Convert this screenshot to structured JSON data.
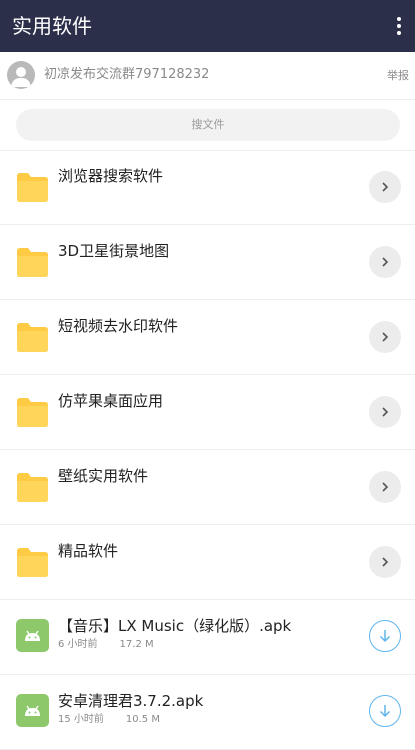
{
  "appbar": {
    "title": "实用软件",
    "menu_icon": "more-vert-icon"
  },
  "owner": {
    "name": "初凉发布交流群797128232",
    "report_label": "举报"
  },
  "search": {
    "label": "搜文件"
  },
  "folders": [
    {
      "label": "浏览器搜索软件"
    },
    {
      "label": "3D卫星街景地图"
    },
    {
      "label": "短视频去水印软件"
    },
    {
      "label": "仿苹果桌面应用"
    },
    {
      "label": "壁纸实用软件"
    },
    {
      "label": "精品软件"
    }
  ],
  "files": [
    {
      "label": "【音乐】LX Music（绿化版）.apk",
      "time": "6 小时前",
      "size": "17.2 M"
    },
    {
      "label": "安卓清理君3.7.2.apk",
      "time": "15 小时前",
      "size": "10.5 M"
    }
  ],
  "colors": {
    "appbar": "#2b2f4a",
    "folder": "#ffcb45",
    "apk_icon": "#8dc86a",
    "download_accent": "#5fb5ec"
  }
}
